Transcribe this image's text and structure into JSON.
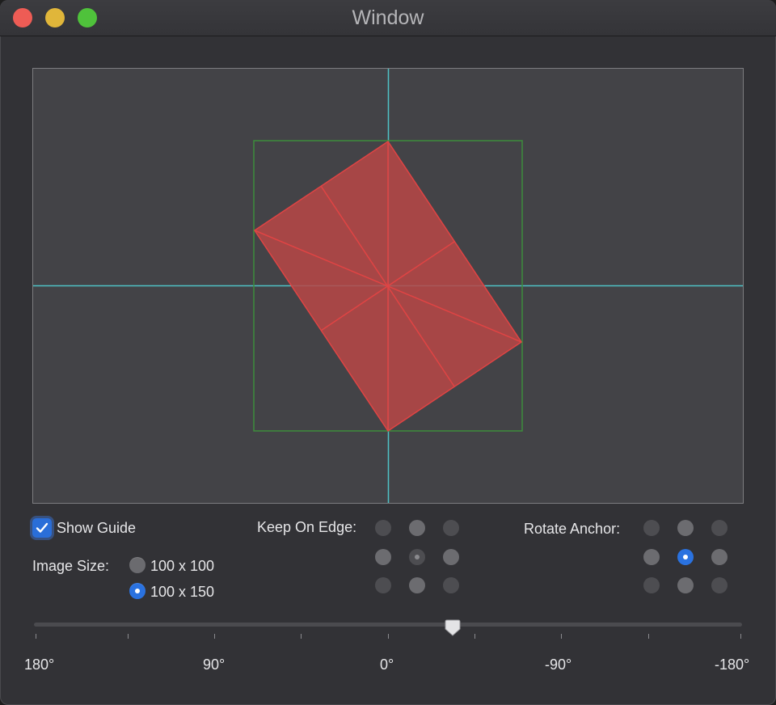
{
  "window": {
    "title": "Window",
    "buttons": {
      "close": "close",
      "minimize": "minimize",
      "zoom": "zoom"
    }
  },
  "canvas": {
    "guide_color": "#4fc3c7",
    "bounds_color": "#3c8c3c",
    "shape_fill": "#b84646",
    "shape_line": "#e04444",
    "rotation_deg": 34
  },
  "controls": {
    "show_guide": {
      "label": "Show Guide",
      "checked": true
    },
    "image_size": {
      "label": "Image Size:",
      "options": [
        {
          "label": "100 x 100",
          "selected": false
        },
        {
          "label": "100 x 150",
          "selected": true
        }
      ]
    },
    "keep_on_edge": {
      "label": "Keep On Edge:",
      "center_enabled": false
    },
    "rotate_anchor": {
      "label": "Rotate Anchor:",
      "selected": "center"
    }
  },
  "slider": {
    "value_deg": -34,
    "labels": [
      "180°",
      "90°",
      "0°",
      "-90°",
      "-180°"
    ]
  },
  "colors": {
    "accent": "#2a72e0"
  },
  "icons": [
    "checkmark-icon",
    "slider-thumb-icon"
  ]
}
